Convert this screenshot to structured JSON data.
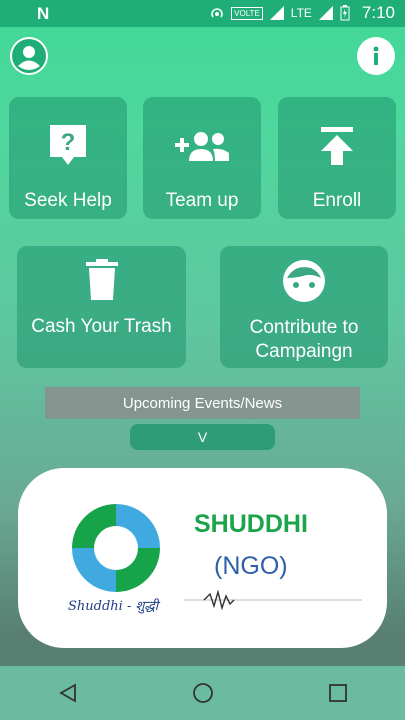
{
  "status_bar": {
    "network_label": "VOLTE",
    "roaming": "R",
    "lte": "LTE",
    "time": "7:10"
  },
  "tiles": {
    "seek_help": "Seek Help",
    "team_up": "Team up",
    "enroll": "Enroll",
    "cash_trash": "Cash Your Trash",
    "contribute_line1": "Contribute to",
    "contribute_line2": "Campaingn"
  },
  "banner": {
    "label": "Upcoming Events/News"
  },
  "toggle": {
    "label": "V"
  },
  "card": {
    "title": "SHUDDHI",
    "subtitle": "(NGO)",
    "logo_caption": "Shuddhi - शुद्धी"
  },
  "icons": {
    "profile": "account-circle-icon",
    "info": "info-icon",
    "help": "question-mark-icon",
    "team": "group-add-icon",
    "enroll": "upload-arrow-icon",
    "trash": "trash-can-icon",
    "contribute": "face-icon"
  },
  "colors": {
    "accent": "#1fae78",
    "ngo_green": "#1aa54a",
    "ngo_blue": "#2d5fa8"
  }
}
